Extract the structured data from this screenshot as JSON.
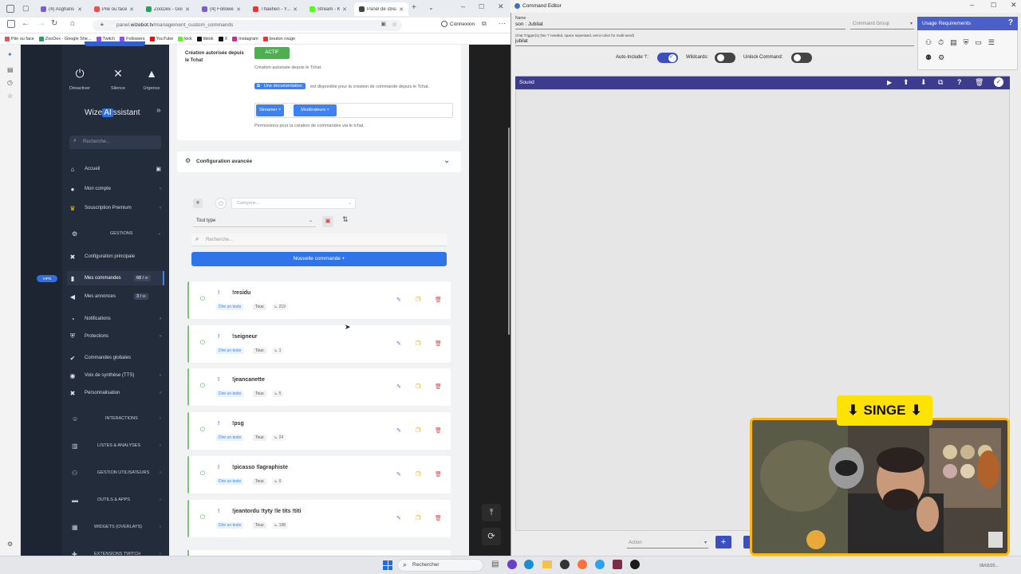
{
  "browser": {
    "tabs": [
      {
        "title": "(4) Asghans",
        "color": "#7b5cd6"
      },
      {
        "title": "Pile ou face - la...",
        "color": "#e25555"
      },
      {
        "title": "ZooDex - Googl...",
        "color": "#22a355"
      },
      {
        "title": "(4) Followers - T...",
        "color": "#7b5cd6"
      },
      {
        "title": "Thaehen - Y...",
        "color": "#e33"
      },
      {
        "title": "Stream - Kic...",
        "color": "#53fc18"
      },
      {
        "title": "Panel de strea...",
        "color": "#444"
      }
    ],
    "url_prefix": "panel.",
    "url_domain": "wizebot.tv",
    "url_path": "/management_custom_commands",
    "connexion": "Connexion",
    "bookmarks": [
      {
        "label": "Pile ou face",
        "color": "#e25555"
      },
      {
        "label": "ZooDex - Google She...",
        "color": "#22a355"
      },
      {
        "label": "Twitch",
        "color": "#9146ff"
      },
      {
        "label": "Followers",
        "color": "#9146ff"
      },
      {
        "label": "YouTube",
        "color": "#ff0000"
      },
      {
        "label": "kick",
        "color": "#53fc18"
      },
      {
        "label": "tiktok",
        "color": "#111111"
      },
      {
        "label": "X",
        "color": "#111111"
      },
      {
        "label": "Instagram",
        "color": "#d6249f"
      },
      {
        "label": "bouton rouge",
        "color": "#e33"
      }
    ]
  },
  "app": {
    "top_actions": [
      {
        "label": "Désactiver",
        "icon": "power-icon"
      },
      {
        "label": "Silence",
        "icon": "mute-icon"
      },
      {
        "label": "Urgence",
        "icon": "alert-icon"
      }
    ],
    "brand": {
      "prefix": "Wize",
      "ai": "AI",
      "suffix": "ssistant"
    },
    "search_placeholder": "Recherche...",
    "menu": [
      {
        "label": "Accueil",
        "icon": "home-icon"
      },
      {
        "label": "Mon compte",
        "icon": "user-icon",
        "arrow": "›"
      },
      {
        "label": "Souscription Premium",
        "icon": "crown-icon",
        "arrow": "›"
      }
    ],
    "gestions_label": "GESTIONS",
    "gestions_items": [
      {
        "label": "Configuration principale",
        "icon": "wrench-icon"
      },
      {
        "label": "Mes commandes",
        "icon": "chat-icon",
        "badge": "68 / ∞"
      },
      {
        "label": "Mes annonces",
        "icon": "megaphone-icon",
        "badge": "3 / ∞"
      },
      {
        "label": "Notifications",
        "icon": "bell-icon",
        "arrow": "›"
      },
      {
        "label": "Protections",
        "icon": "shield-icon",
        "arrow": "›"
      },
      {
        "label": "Commandes globales",
        "icon": "globe-icon"
      },
      {
        "label": "Voix de synthèse (TTS)",
        "icon": "voice-icon",
        "arrow": "›"
      },
      {
        "label": "Personnalisation",
        "icon": "brush-icon",
        "arrow": "›"
      }
    ],
    "sections": [
      {
        "label": "INTERACTIONS",
        "icon": "interaction-icon"
      },
      {
        "label": "LISTES & ANALYSES",
        "icon": "chart-icon"
      },
      {
        "label": "GESTION UTILISATEURS",
        "icon": "users-icon"
      },
      {
        "label": "OUTILS & APPS",
        "icon": "toolbox-icon"
      },
      {
        "label": "WIDGETS (OVERLAYS)",
        "icon": "widgets-icon"
      },
      {
        "label": "EXTENSIONS TWITCH",
        "icon": "puzzle-icon"
      }
    ],
    "vip_badge": "VIPO"
  },
  "settings": {
    "creation_label": "Création autorisée depuis le Tchat",
    "actif": "ACTIF",
    "creation_help": "Création autorisée depuis le Tchat.",
    "doc_link": "Une documentation",
    "doc_text": "est disponible pour la création de commande depuis le Tchat.",
    "roles": [
      "Streamer ×",
      "Modérateurs ×"
    ],
    "roles_help": "Permissions pour la création de commandes via le tchat.",
    "advanced_title": "Configuration avancée"
  },
  "filters": {
    "category_placeholder": "Catégorie...",
    "type_value": "Tout type",
    "search_placeholder": "Recherche...",
    "new_command": "Nouvelle commande"
  },
  "commands": [
    {
      "name": "!residu",
      "type": "Dire un texte",
      "who": "Tous",
      "count": "219"
    },
    {
      "name": "!seigneur",
      "type": "Dire un texte",
      "who": "Tous",
      "count": "1"
    },
    {
      "name": "!jeancanette",
      "type": "Dire un texte",
      "who": "Tous",
      "count": "5"
    },
    {
      "name": "!psg",
      "type": "Dire un texte",
      "who": "Tous",
      "count": "24"
    },
    {
      "name": "!picasso !lagraphiste",
      "type": "Dire un texte",
      "who": "Tous",
      "count": "9"
    },
    {
      "name": "!jeantordu !tyty !le tits !titi",
      "type": "Dire un texte",
      "who": "Tous",
      "count": "198"
    }
  ],
  "editor": {
    "title": "Command Editor",
    "name_label": "Name",
    "name_value": "son : Jubilat",
    "group_placeholder": "Command Group",
    "trigger_label": "Chat Trigger(s) (No '!' needed, space seperated, semi-colon for multi-word)",
    "trigger_value": "jubilat",
    "auto_include": "Auto-Include '!':",
    "wildcards": "Wildcards:",
    "unlock": "Unlock Command:",
    "usage_title": "Usage Requirements",
    "sound_label": "Sound",
    "action_placeholder": "Action"
  },
  "overlay": {
    "singe": "SINGE"
  },
  "taskbar": {
    "search": "Rechercher",
    "date": "06/02/20..."
  }
}
